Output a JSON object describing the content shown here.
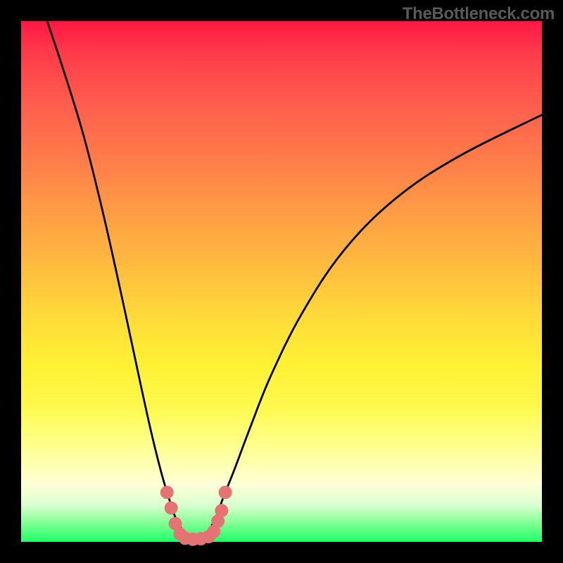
{
  "watermark": "TheBottleneck.com",
  "colors": {
    "frame": "#000000",
    "gradient_top": "#ff1744",
    "gradient_mid": "#ffea00",
    "gradient_bottom": "#1eff66",
    "curve": "#000000",
    "dot": "#e57373"
  },
  "chart_data": {
    "type": "line",
    "title": "",
    "xlabel": "",
    "ylabel": "",
    "xlim": [
      0,
      100
    ],
    "ylim": [
      0,
      100
    ],
    "grid": false,
    "legend": null,
    "series": [
      {
        "name": "left-branch",
        "x": [
          5,
          8,
          12,
          16,
          20,
          23,
          25,
          27,
          28.5,
          29.5,
          30.5,
          31.5,
          32.5
        ],
        "y": [
          100,
          91,
          78,
          62,
          44,
          30,
          21,
          13,
          8,
          5,
          3,
          1.5,
          0.5
        ]
      },
      {
        "name": "right-branch",
        "x": [
          35,
          36,
          37.5,
          39,
          41,
          44,
          48,
          54,
          62,
          72,
          84,
          100
        ],
        "y": [
          0.5,
          2,
          5,
          9,
          14,
          22,
          32,
          44,
          56,
          66,
          74,
          82
        ]
      }
    ],
    "dots": {
      "name": "bottom-cluster",
      "points": [
        {
          "x": 28,
          "y": 9.5
        },
        {
          "x": 28.8,
          "y": 6.5
        },
        {
          "x": 29.6,
          "y": 3.5
        },
        {
          "x": 30.5,
          "y": 1.5
        },
        {
          "x": 31.5,
          "y": 0.7
        },
        {
          "x": 33,
          "y": 0.5
        },
        {
          "x": 34.5,
          "y": 0.6
        },
        {
          "x": 36,
          "y": 1
        },
        {
          "x": 37,
          "y": 2
        },
        {
          "x": 37.8,
          "y": 4
        },
        {
          "x": 38.5,
          "y": 6
        },
        {
          "x": 39.2,
          "y": 9.5
        }
      ]
    }
  }
}
